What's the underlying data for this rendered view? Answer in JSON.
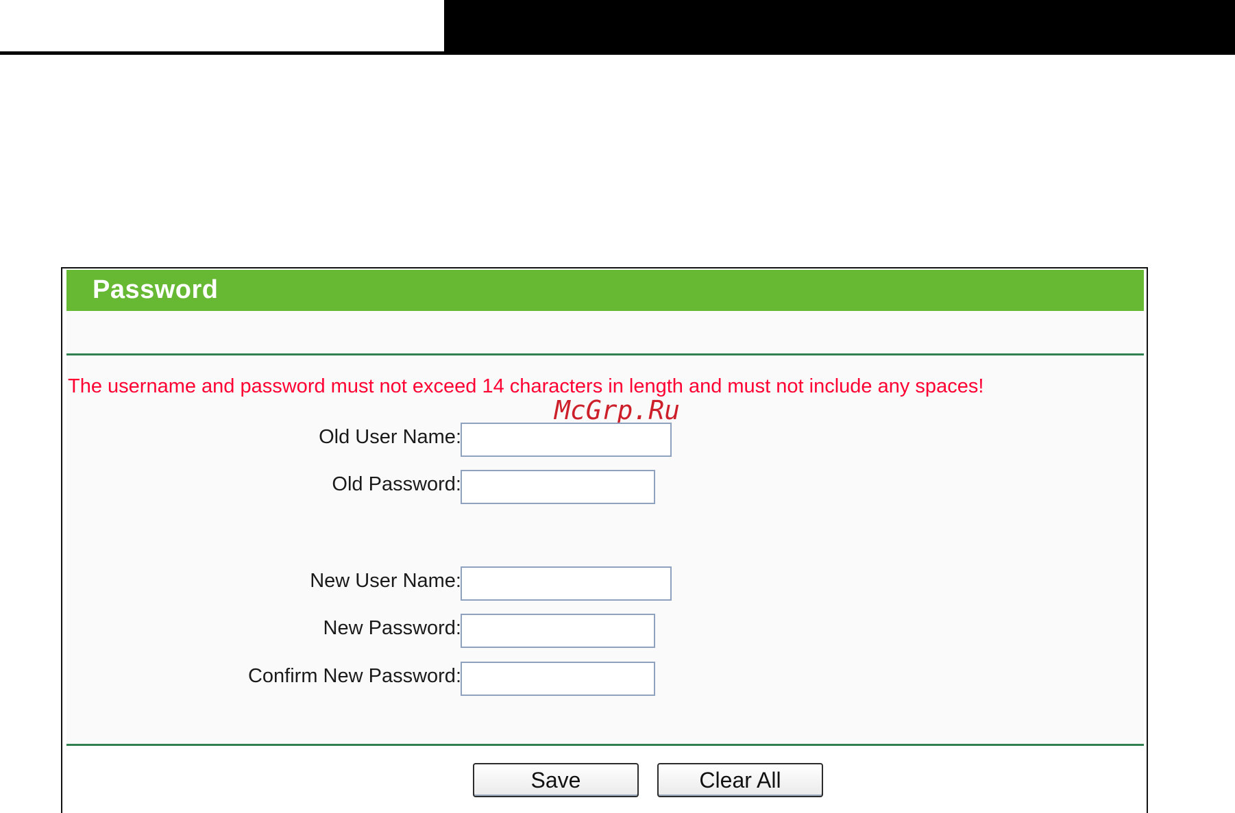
{
  "panel": {
    "title": "Password",
    "notice": "The username and password must not exceed 14 characters in length and must not include any spaces!"
  },
  "watermark": "McGrp.Ru",
  "fields": {
    "old_user_name": {
      "label": "Old User Name:",
      "value": ""
    },
    "old_password": {
      "label": "Old Password:",
      "value": ""
    },
    "new_user_name": {
      "label": "New User Name:",
      "value": ""
    },
    "new_password": {
      "label": "New Password:",
      "value": ""
    },
    "confirm_new_password": {
      "label": "Confirm New Password:",
      "value": ""
    }
  },
  "buttons": {
    "save": "Save",
    "clear_all": "Clear All"
  },
  "colors": {
    "header_green": "#67b934",
    "divider_green": "#2f7f4f",
    "notice_red": "#ff0033",
    "input_border": "#8ea2bf"
  }
}
